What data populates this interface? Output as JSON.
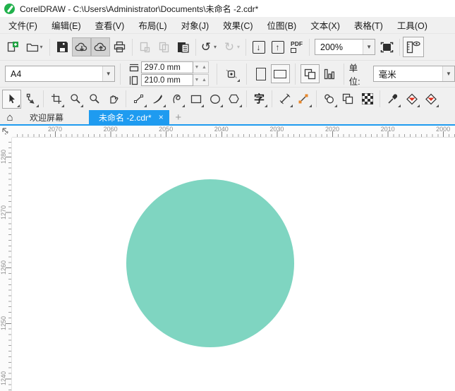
{
  "window": {
    "title": "CorelDRAW - C:\\Users\\Administrator\\Documents\\未命名 -2.cdr*",
    "logo_color": "#21b14c"
  },
  "menubar": {
    "items": [
      "文件(F)",
      "编辑(E)",
      "查看(V)",
      "布局(L)",
      "对象(J)",
      "效果(C)",
      "位图(B)",
      "文本(X)",
      "表格(T)",
      "工具(O)"
    ]
  },
  "toolbar": {
    "buttons": [
      "new-document",
      "open",
      "save",
      "cloud-download",
      "cloud-upload",
      "print",
      "cut",
      "copy",
      "paste",
      "undo",
      "redo",
      "import",
      "export",
      "publish-pdf",
      "zoom-level-combobox",
      "full-screen-preview",
      "show-rulers"
    ],
    "pressed_buttons": [
      "cloud-download",
      "cloud-upload"
    ],
    "disabled_buttons": [
      "cut",
      "copy",
      "redo"
    ],
    "undo_glyph": "↺",
    "redo_glyph": "↻",
    "import_glyph": "↓",
    "export_glyph": "↑",
    "pdf_label": "PDF",
    "zoom_level": "200%"
  },
  "property_bar": {
    "page_size": "A4",
    "page_width": "297.0 mm",
    "page_height": "210.0 mm",
    "orientation": "landscape",
    "units_label": "单位:",
    "units_value": "毫米",
    "buttons": [
      "page-size-combobox",
      "page-width-field",
      "page-height-field",
      "snap-to",
      "portrait",
      "landscape",
      "all-pages",
      "single-page",
      "units-combobox"
    ]
  },
  "toolbox": {
    "tools": [
      "pick",
      "shape",
      "crop",
      "zoom",
      "zoom-secondary",
      "pan",
      "freehand",
      "artistic-media",
      "bspline",
      "rectangle",
      "ellipse",
      "polygon",
      "text",
      "dimension",
      "connector",
      "drop-shadow",
      "transparency",
      "mesh-fill",
      "eyedropper",
      "interactive-fill",
      "smart-fill"
    ],
    "selected_tool": "pick",
    "text_tool_glyph": "字"
  },
  "tabs": {
    "welcome_label": "欢迎屏幕",
    "document_label": "未命名 -2.cdr*",
    "close_glyph": "×",
    "new_tab_glyph": "+",
    "home_glyph": "⌂",
    "active_color": "#1e9bf0"
  },
  "rulers": {
    "horizontal": {
      "labels": [
        "2070",
        "2060",
        "2050",
        "2040",
        "2030",
        "2020",
        "2010",
        "2000"
      ]
    },
    "vertical": {
      "labels": [
        "1280",
        "1270",
        "1260",
        "1250",
        "1240"
      ]
    }
  },
  "canvas": {
    "shape": {
      "type": "ellipse",
      "fill": "#7fd5c1"
    }
  }
}
